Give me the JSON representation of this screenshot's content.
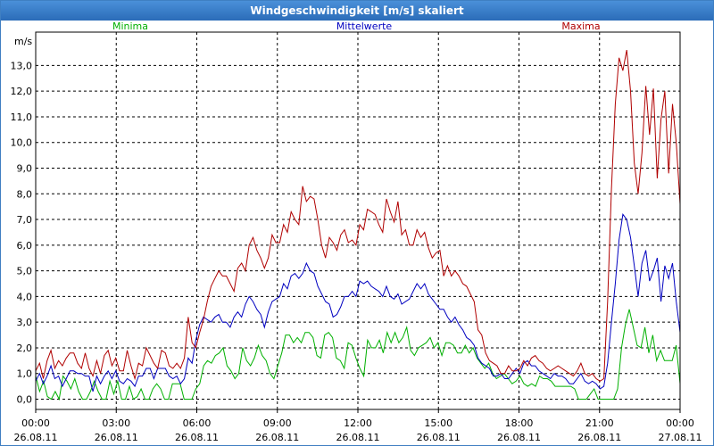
{
  "window": {
    "title": "Windgeschwindigkeit [m/s] skaliert"
  },
  "chart_data": {
    "type": "line",
    "title": "Windgeschwindigkeit [m/s] skaliert",
    "ylabel": "m/s",
    "ylim": [
      -0.4,
      14.3
    ],
    "xlim": [
      0,
      24
    ],
    "grid": true,
    "y_ticks": [
      "0,0",
      "1,0",
      "2,0",
      "3,0",
      "4,0",
      "5,0",
      "6,0",
      "7,0",
      "8,0",
      "9,0",
      "10,0",
      "11,0",
      "12,0",
      "13,0"
    ],
    "x_ticks": [
      {
        "time": "00:00",
        "date": "26.08.11"
      },
      {
        "time": "03:00",
        "date": "26.08.11"
      },
      {
        "time": "06:00",
        "date": "26.08.11"
      },
      {
        "time": "09:00",
        "date": "26.08.11"
      },
      {
        "time": "12:00",
        "date": "26.08.11"
      },
      {
        "time": "15:00",
        "date": "26.08.11"
      },
      {
        "time": "18:00",
        "date": "26.08.11"
      },
      {
        "time": "21:00",
        "date": "26.08.11"
      },
      {
        "time": "00:00",
        "date": "27.08.11"
      }
    ],
    "series": [
      {
        "name": "Minima",
        "color": "#00b000",
        "values": [
          0.9,
          0.3,
          0.7,
          0.1,
          0,
          0.3,
          0,
          0.9,
          0.7,
          0.4,
          0.8,
          0.3,
          0,
          0,
          0.3,
          0.7,
          0.3,
          0,
          0,
          0.7,
          0.2,
          0.7,
          0,
          0,
          0.5,
          0,
          0.1,
          0.4,
          0,
          0,
          0.4,
          0.6,
          0.4,
          0,
          0,
          0.6,
          0.6,
          0.6,
          0,
          0,
          0,
          0.4,
          0.6,
          1.3,
          1.5,
          1.4,
          1.7,
          1.8,
          2.0,
          1.3,
          1.1,
          0.8,
          1.0,
          2.0,
          1.5,
          1.3,
          1.6,
          2.1,
          1.7,
          1.5,
          1.0,
          0.8,
          1.3,
          1.8,
          2.5,
          2.5,
          2.2,
          2.4,
          2.2,
          2.6,
          2.6,
          2.4,
          1.7,
          1.6,
          2.5,
          2.6,
          2.4,
          1.6,
          1.5,
          1.2,
          2.2,
          2.1,
          1.6,
          1.2,
          0.9,
          2.3,
          2.0,
          2.0,
          2.3,
          1.8,
          2.6,
          2.2,
          2.6,
          2.2,
          2.4,
          2.8,
          1.9,
          1.7,
          2.0,
          2.1,
          2.2,
          2.4,
          2.0,
          2.2,
          1.7,
          2.2,
          2.2,
          2.1,
          1.8,
          1.8,
          2.1,
          1.8,
          2.0,
          1.6,
          1.4,
          1.2,
          1.4,
          1.0,
          0.8,
          0.9,
          1.0,
          0.8,
          0.6,
          0.7,
          0.9,
          0.6,
          0.5,
          0.6,
          0.5,
          0.9,
          0.8,
          0.8,
          0.7,
          0.5,
          0.5,
          0.5,
          0.5,
          0.5,
          0.4,
          0,
          0,
          0,
          0.2,
          0.4,
          0,
          0,
          0,
          0,
          0,
          0.4,
          2.0,
          2.9,
          3.5,
          2.8,
          2.1,
          2.0,
          2.8,
          1.8,
          2.5,
          1.5,
          1.9,
          1.5,
          1.5,
          1.5,
          2.1,
          0.6
        ]
      },
      {
        "name": "Mittelwerte",
        "color": "#0000c0",
        "values": [
          0.7,
          1.0,
          0.6,
          0.9,
          1.3,
          0.8,
          0.9,
          0.5,
          0.8,
          1.1,
          1.1,
          1.0,
          1.0,
          0.9,
          0.9,
          0.3,
          0.9,
          0.6,
          0.9,
          1.1,
          0.8,
          1.1,
          0.7,
          0.6,
          0.8,
          0.7,
          0.5,
          0.9,
          0.9,
          1.2,
          1.2,
          0.8,
          1.2,
          1.2,
          1.2,
          0.9,
          0.8,
          0.9,
          0.6,
          0.8,
          1.6,
          1.4,
          2.3,
          2.9,
          3.2,
          3.1,
          3.0,
          3.2,
          3.3,
          3.0,
          3.0,
          2.8,
          3.2,
          3.4,
          3.2,
          3.7,
          4.0,
          3.8,
          3.5,
          3.3,
          2.8,
          3.4,
          3.8,
          3.9,
          4.0,
          4.5,
          4.3,
          4.8,
          4.9,
          4.7,
          4.9,
          5.3,
          5.0,
          4.9,
          4.4,
          4.1,
          3.8,
          3.7,
          3.2,
          3.3,
          3.6,
          4.0,
          4.0,
          4.2,
          4.0,
          4.6,
          4.5,
          4.6,
          4.4,
          4.3,
          4.2,
          4.0,
          4.4,
          4.0,
          3.9,
          4.1,
          3.7,
          3.8,
          3.9,
          4.2,
          4.5,
          4.3,
          4.5,
          4.1,
          3.9,
          3.7,
          3.5,
          3.5,
          3.2,
          3.0,
          3.2,
          2.9,
          2.7,
          2.4,
          2.3,
          2.1,
          1.6,
          1.4,
          1.3,
          1.2,
          0.9,
          0.9,
          1.0,
          0.8,
          0.8,
          1.0,
          1.2,
          1.0,
          1.4,
          1.5,
          1.3,
          1.3,
          1.1,
          1.0,
          0.9,
          0.8,
          1.0,
          0.9,
          0.9,
          0.8,
          0.6,
          0.6,
          0.8,
          1.0,
          0.7,
          0.6,
          0.7,
          0.6,
          0.4,
          0.5,
          1.4,
          3.0,
          4.5,
          6.2,
          7.2,
          7.0,
          6.3,
          5.2,
          4.0,
          5.3,
          5.8,
          4.6,
          5.0,
          5.5,
          3.8,
          5.2,
          4.7,
          5.3,
          3.8,
          2.6
        ]
      },
      {
        "name": "Maxima",
        "color": "#b00000",
        "values": [
          1.1,
          1.4,
          0.8,
          1.5,
          1.9,
          1.2,
          1.5,
          1.3,
          1.6,
          1.8,
          1.8,
          1.4,
          1.2,
          1.8,
          1.2,
          0.9,
          1.5,
          1.0,
          1.7,
          1.9,
          1.3,
          1.6,
          1.1,
          1.1,
          1.9,
          1.3,
          0.8,
          1.4,
          1.3,
          2.0,
          1.7,
          1.4,
          1.2,
          1.9,
          1.8,
          1.3,
          1.2,
          1.4,
          1.2,
          1.6,
          3.2,
          2.2,
          2.0,
          2.6,
          3.1,
          3.8,
          4.4,
          4.7,
          5.0,
          4.8,
          4.8,
          4.5,
          4.2,
          5.1,
          5.3,
          5.0,
          6.0,
          6.3,
          5.8,
          5.5,
          5.1,
          5.5,
          6.4,
          6.1,
          6.1,
          6.8,
          6.5,
          7.3,
          7.0,
          6.8,
          8.3,
          7.7,
          7.9,
          7.8,
          7.0,
          6.0,
          5.5,
          6.3,
          6.1,
          5.8,
          6.4,
          6.6,
          6.1,
          6.2,
          6.0,
          6.8,
          6.6,
          7.4,
          7.3,
          7.2,
          6.8,
          6.5,
          7.8,
          7.3,
          6.9,
          7.7,
          6.4,
          6.6,
          6.0,
          6.0,
          6.6,
          6.3,
          6.5,
          5.9,
          5.5,
          5.7,
          5.8,
          4.8,
          5.2,
          4.8,
          5.0,
          4.8,
          4.5,
          4.4,
          4.1,
          3.8,
          2.7,
          2.5,
          1.8,
          1.5,
          1.4,
          1.3,
          1.0,
          1.0,
          1.3,
          1.1,
          1.1,
          1.2,
          1.5,
          1.3,
          1.6,
          1.7,
          1.5,
          1.4,
          1.2,
          1.1,
          1.2,
          1.3,
          1.2,
          1.1,
          1.0,
          0.9,
          1.1,
          1.4,
          1.0,
          0.9,
          1.0,
          0.8,
          0.7,
          0.8,
          3.8,
          8.2,
          11.5,
          13.3,
          12.8,
          13.6,
          12.0,
          9.2,
          8.0,
          9.6,
          12.2,
          10.3,
          12.1,
          8.6,
          10.9,
          12.0,
          8.8,
          11.5,
          10.0,
          7.6
        ]
      }
    ]
  }
}
